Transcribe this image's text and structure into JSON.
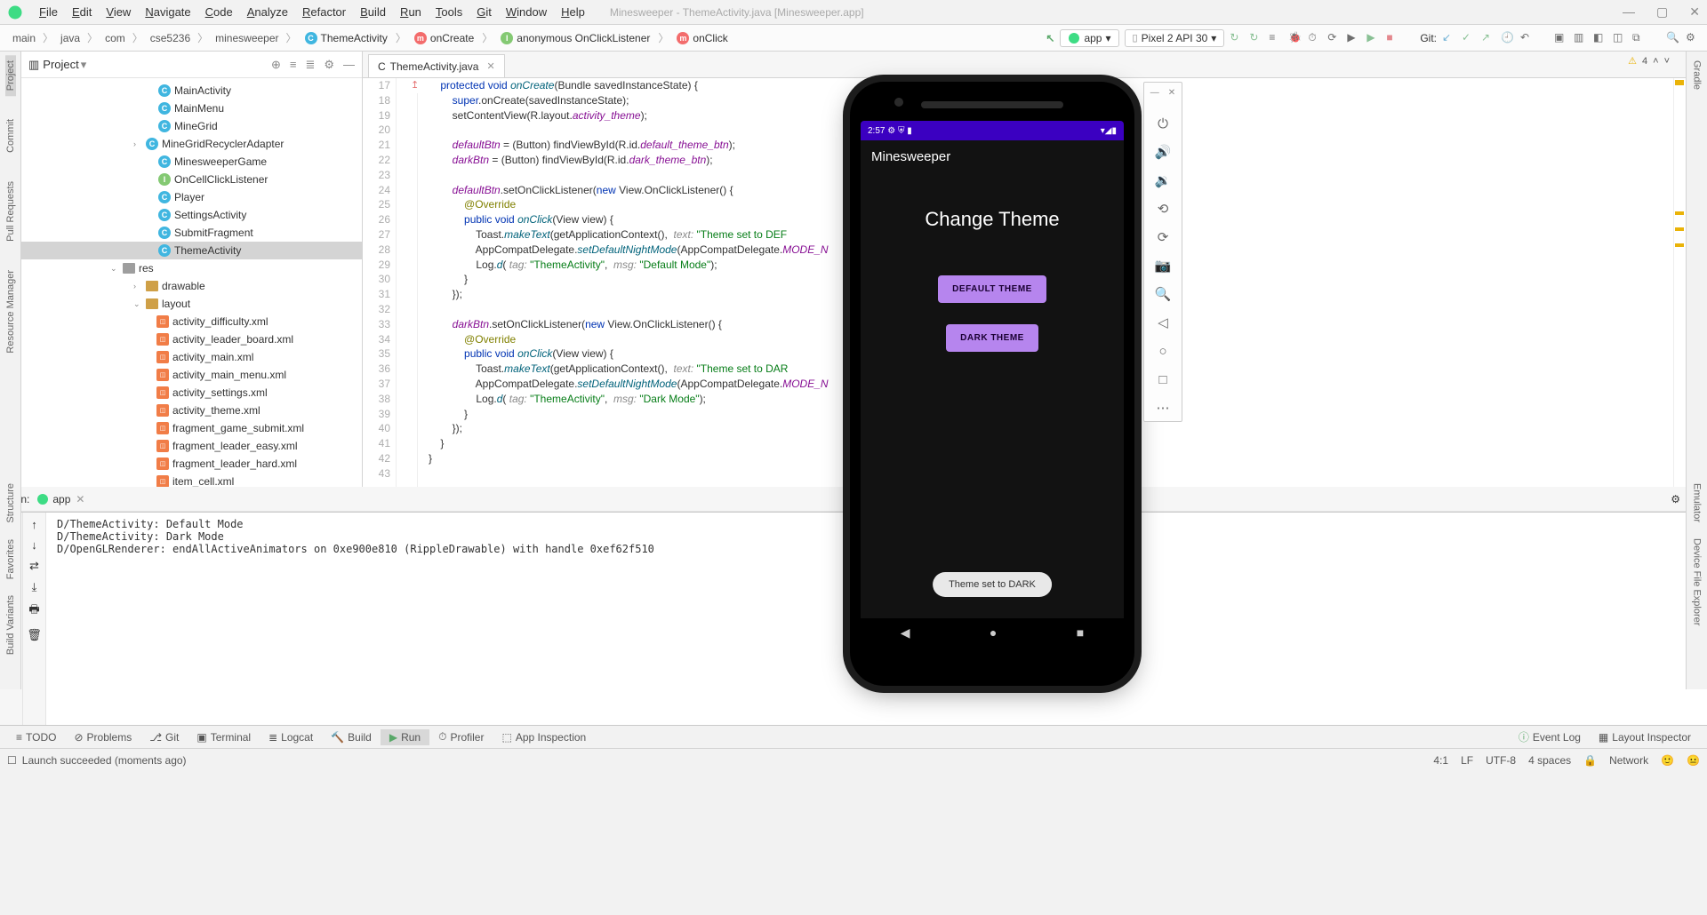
{
  "window": {
    "title": "Minesweeper - ThemeActivity.java [Minesweeper.app]"
  },
  "menu": [
    "File",
    "Edit",
    "View",
    "Navigate",
    "Code",
    "Analyze",
    "Refactor",
    "Build",
    "Run",
    "Tools",
    "Git",
    "Window",
    "Help"
  ],
  "breadcrumbs": [
    "main",
    "java",
    "com",
    "cse5236",
    "minesweeper"
  ],
  "breadcrumb_pills": [
    {
      "icon": "c",
      "label": "ThemeActivity"
    },
    {
      "icon": "m",
      "label": "onCreate"
    },
    {
      "icon": "i",
      "label": "anonymous OnClickListener"
    },
    {
      "icon": "m",
      "label": "onClick"
    }
  ],
  "run_config": "app",
  "device": "Pixel 2 API 30",
  "git_label": "Git:",
  "project_panel_title": "Project",
  "tree_classes": [
    "MainActivity",
    "MainMenu",
    "MineGrid",
    "MineGridRecyclerAdapter",
    "MinesweeperGame",
    "OnCellClickListener",
    "Player",
    "SettingsActivity",
    "SubmitFragment",
    "ThemeActivity"
  ],
  "tree_res_label": "res",
  "tree_drawable_label": "drawable",
  "tree_layout_label": "layout",
  "tree_layout_files": [
    "activity_difficulty.xml",
    "activity_leader_board.xml",
    "activity_main.xml",
    "activity_main_menu.xml",
    "activity_settings.xml",
    "activity_theme.xml",
    "fragment_game_submit.xml",
    "fragment_leader_easy.xml",
    "fragment_leader_hard.xml",
    "item_cell.xml"
  ],
  "tab_name": "ThemeActivity.java",
  "code_linenums": [
    17,
    18,
    19,
    20,
    21,
    22,
    23,
    24,
    25,
    26,
    27,
    28,
    29,
    30,
    31,
    32,
    33,
    34,
    35,
    36,
    37,
    38,
    39,
    40,
    41,
    42,
    43
  ],
  "warning_count": "4",
  "cursor": "4:1",
  "run_tab_label": "Run:",
  "run_tab_name": "app",
  "console_lines": [
    "D/ThemeActivity: Default Mode",
    "D/ThemeActivity: Dark Mode",
    "D/OpenGLRenderer: endAllActiveAnimators on 0xe900e810 (RippleDrawable) with handle 0xef62f510"
  ],
  "bottom_tools": [
    "TODO",
    "Problems",
    "Git",
    "Terminal",
    "Logcat",
    "Build",
    "Run",
    "Profiler",
    "App Inspection"
  ],
  "bottom_right": [
    "Event Log",
    "Layout Inspector"
  ],
  "status_msg": "Launch succeeded (moments ago)",
  "status_right": [
    "4:1",
    "LF",
    "UTF-8",
    "4 spaces",
    "Network"
  ],
  "left_tabs": [
    "Project",
    "Commit",
    "Pull Requests",
    "Resource Manager"
  ],
  "left_tabs_bottom": [
    "Structure",
    "Favorites",
    "Build Variants"
  ],
  "right_tabs": [
    "Gradle",
    "Emulator",
    "Device File Explorer"
  ],
  "emulator": {
    "time": "2:57",
    "app_title": "Minesweeper",
    "heading": "Change Theme",
    "btn_default": "DEFAULT THEME",
    "btn_dark": "DARK THEME",
    "toast": "Theme set to DARK"
  }
}
